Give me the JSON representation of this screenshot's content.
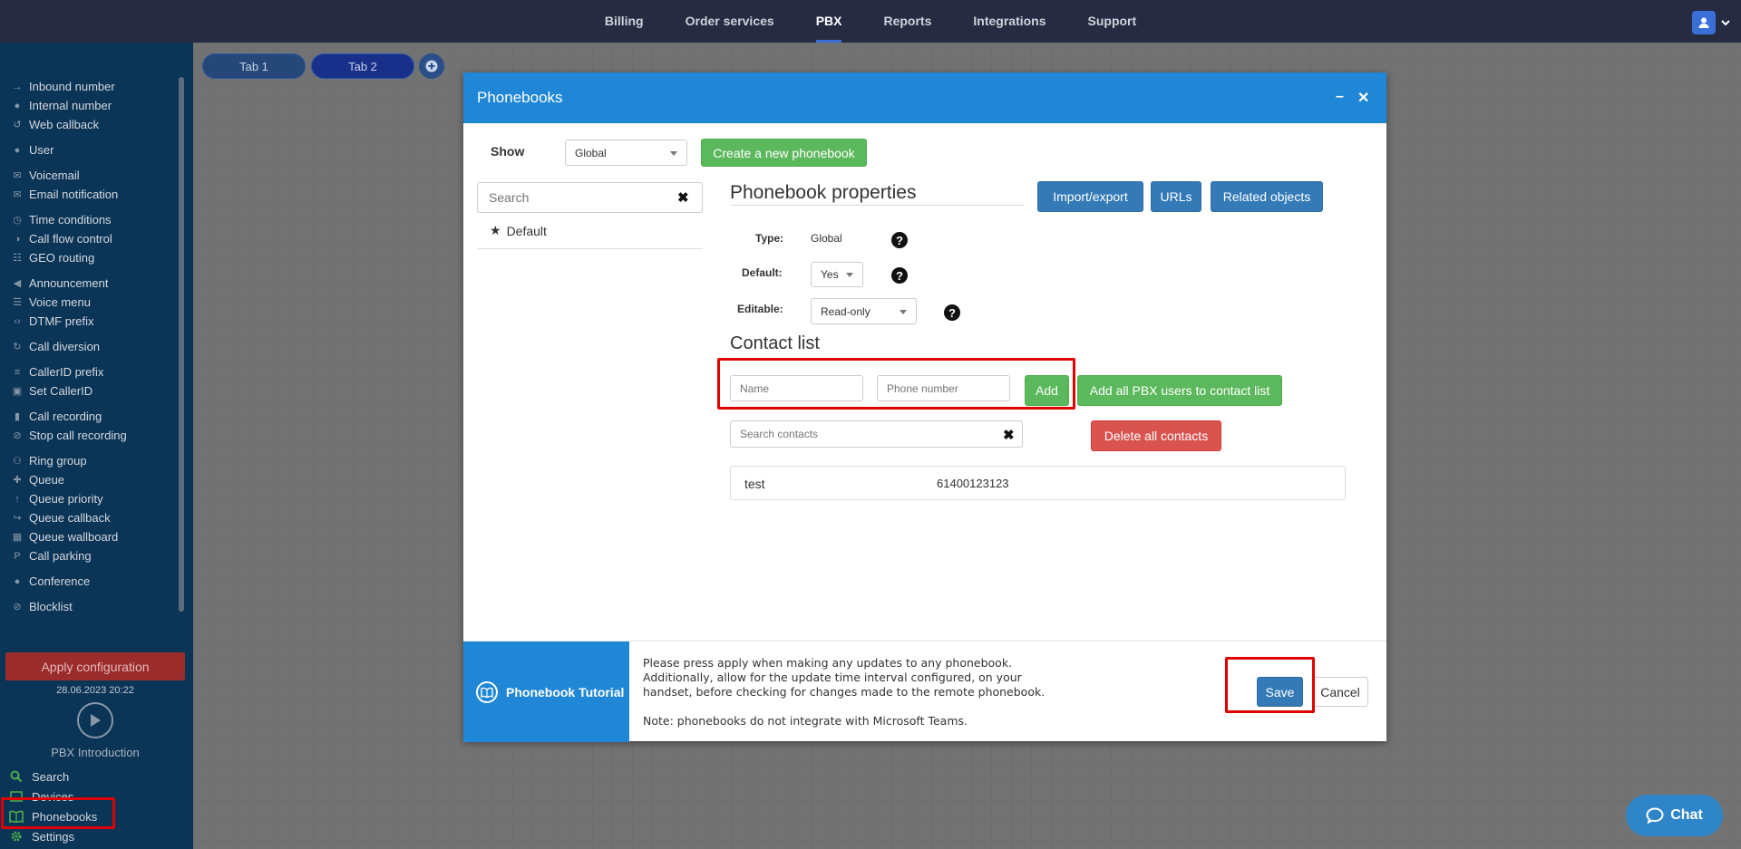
{
  "topnav": {
    "items": [
      "Billing",
      "Order services",
      "PBX",
      "Reports",
      "Integrations",
      "Support"
    ],
    "active": "PBX"
  },
  "sidebar": {
    "groups": [
      [
        {
          "label": "Inbound number",
          "icon": "arrow-in-icon"
        },
        {
          "label": "Internal number",
          "icon": "pin-icon"
        },
        {
          "label": "Web callback",
          "icon": "callback-icon"
        }
      ],
      [
        {
          "label": "User",
          "icon": "user-icon"
        }
      ],
      [
        {
          "label": "Voicemail",
          "icon": "envelope-icon"
        },
        {
          "label": "Email notification",
          "icon": "envelope-icon"
        }
      ],
      [
        {
          "label": "Time conditions",
          "icon": "clock-icon"
        },
        {
          "label": "Call flow control",
          "icon": "toggle-icon"
        },
        {
          "label": "GEO routing",
          "icon": "sitemap-icon"
        }
      ],
      [
        {
          "label": "Announcement",
          "icon": "bullhorn-icon"
        },
        {
          "label": "Voice menu",
          "icon": "menu-grid-icon"
        },
        {
          "label": "DTMF prefix",
          "icon": "code-icon"
        }
      ],
      [
        {
          "label": "Call diversion",
          "icon": "refresh-icon"
        }
      ],
      [
        {
          "label": "CallerID prefix",
          "icon": "list-icon"
        },
        {
          "label": "Set CallerID",
          "icon": "id-card-icon"
        }
      ],
      [
        {
          "label": "Call recording",
          "icon": "microphone-icon"
        },
        {
          "label": "Stop call recording",
          "icon": "microphone-slash-icon"
        }
      ],
      [
        {
          "label": "Ring group",
          "icon": "users-icon"
        },
        {
          "label": "Queue",
          "icon": "user-plus-icon"
        },
        {
          "label": "Queue priority",
          "icon": "arrow-up-icon"
        },
        {
          "label": "Queue callback",
          "icon": "share-icon"
        },
        {
          "label": "Queue wallboard",
          "icon": "table-icon"
        },
        {
          "label": "Call parking",
          "icon": "parking-icon"
        }
      ],
      [
        {
          "label": "Conference",
          "icon": "comments-icon"
        }
      ],
      [
        {
          "label": "Blocklist",
          "icon": "ban-icon"
        }
      ]
    ],
    "apply_label": "Apply configuration",
    "apply_date": "28.06.2023 20:22",
    "intro_label": "PBX Introduction",
    "bottom": [
      {
        "label": "Search",
        "icon": "search-icon"
      },
      {
        "label": "Devices",
        "icon": "devices-icon"
      },
      {
        "label": "Phonebooks",
        "icon": "book-icon"
      },
      {
        "label": "Settings",
        "icon": "gear-icon"
      }
    ]
  },
  "tabs": {
    "tab1": "Tab 1",
    "tab2": "Tab 2"
  },
  "modal": {
    "title": "Phonebooks",
    "show_label": "Show",
    "show_value": "Global",
    "create_button": "Create a new phonebook",
    "search_placeholder": "Search",
    "phonebooks": [
      "Default"
    ],
    "properties_title": "Phonebook properties",
    "import_export": "Import/export",
    "urls": "URLs",
    "related_objects": "Related objects",
    "type_label": "Type:",
    "type_value": "Global",
    "default_label": "Default:",
    "default_value": "Yes",
    "editable_label": "Editable:",
    "editable_value": "Read-only",
    "contact_list_title": "Contact list",
    "name_placeholder": "Name",
    "phone_placeholder": "Phone number",
    "add_button": "Add",
    "add_all_button": "Add all PBX users to contact list",
    "search_contacts_placeholder": "Search contacts",
    "delete_all_button": "Delete all contacts",
    "contacts": [
      {
        "name": "test",
        "phone": "61400123123"
      }
    ],
    "tutorial_label": "Phonebook Tutorial",
    "footer_lines": [
      "Please press apply when making any updates to any phonebook.",
      "Additionally, allow for the update time interval configured, on your",
      "handset, before checking for changes made to the remote phonebook."
    ],
    "footer_note": "Note: phonebooks do not integrate with Microsoft Teams.",
    "save_button": "Save",
    "cancel_button": "Cancel"
  },
  "chat": {
    "label": "Chat"
  },
  "colors": {
    "topbar": "#262b42",
    "sidebar": "#0b3557",
    "modal_header": "#1f87d6",
    "green": "#5cb85c",
    "blue": "#337ab7",
    "red": "#d9534f",
    "highlight": "#e00000"
  }
}
